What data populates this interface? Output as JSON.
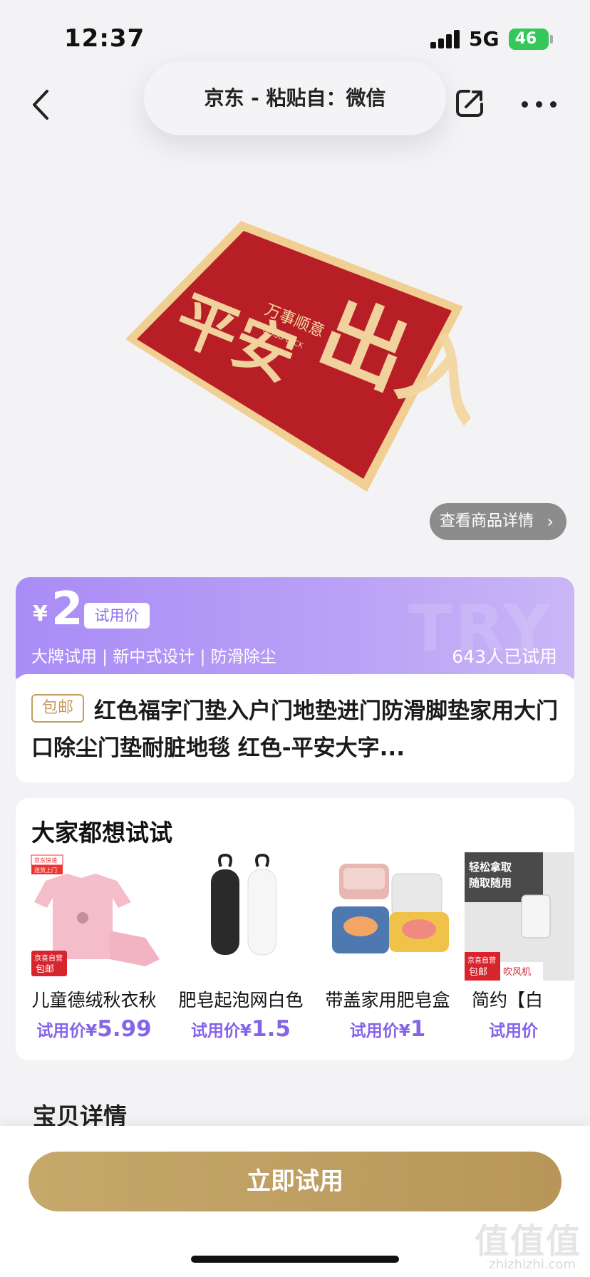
{
  "status": {
    "time": "12:37",
    "network": "5G",
    "battery": "46"
  },
  "nav": {
    "title": "京东 - 粘贴自：微信"
  },
  "product": {
    "detail_link": "查看商品详情",
    "price_currency": "¥",
    "price": "2",
    "price_tag": "试用价",
    "features": "大牌试用 | 新中式设计 | 防滑除尘",
    "trial_count": "643人已试用",
    "watermark": "TRY",
    "shipping_badge": "包邮",
    "title": "红色福字门垫入户门地垫进门防滑脚垫家用大门口除尘门垫耐脏地毯 红色-平安大字..."
  },
  "recommend": {
    "title": "大家都想试试",
    "items": [
      {
        "name": "儿童德绒秋衣秋",
        "price_label": "试用价¥",
        "price": "5.99",
        "badge_top": "京东快递",
        "badge_sub": "送货上门",
        "badge_bottom": "京喜自营",
        "badge_bottom2": "包邮"
      },
      {
        "name": "肥皂起泡网白色",
        "price_label": "试用价¥",
        "price": "1.5"
      },
      {
        "name": "带盖家用肥皂盒",
        "price_label": "试用价¥",
        "price": "1"
      },
      {
        "name": "简约【白",
        "price_label": "试用价",
        "price": "",
        "thumb_line1": "轻松拿取",
        "thumb_line2": "随取随用",
        "badge_bottom": "京喜自营",
        "badge_bottom2": "包邮",
        "badge_bottom3": "吹风机"
      }
    ]
  },
  "mat": {
    "text_left": "平安",
    "text_right": "出入",
    "slogan": "万事顺意",
    "slogan_en": "GOOD LUCK"
  },
  "section": {
    "details": "宝贝详情"
  },
  "cta": {
    "label": "立即试用"
  },
  "watermark": {
    "main": "值值值",
    "sub": "zhizhizhi.com"
  },
  "colors": {
    "accent_purple": "#a98cf6",
    "gold": "#c6a86b",
    "mat_red": "#b81e25",
    "mat_cream": "#f3d7a2"
  }
}
